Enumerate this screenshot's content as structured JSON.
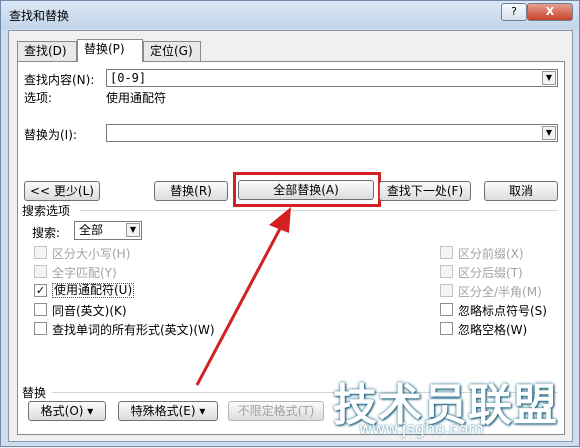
{
  "window": {
    "title": "查找和替换",
    "help_label": "?",
    "close_label": "X"
  },
  "tabs": [
    {
      "label": "查找(D)"
    },
    {
      "label": "替换(P)"
    },
    {
      "label": "定位(G)"
    }
  ],
  "find": {
    "label": "查找内容(N):",
    "value": "[0-9]"
  },
  "options": {
    "label": "选项:",
    "value": "使用通配符"
  },
  "replace": {
    "label": "替换为(I):",
    "value": ""
  },
  "buttons": {
    "less": "<< 更少(L)",
    "replace": "替换(R)",
    "replace_all": "全部替换(A)",
    "find_next": "查找下一处(F)",
    "cancel": "取消"
  },
  "search_options": {
    "title": "搜索选项",
    "search_label": "搜索:",
    "search_value": "全部",
    "left": [
      {
        "label": "区分大小写(H)",
        "checked": false,
        "disabled": true
      },
      {
        "label": "全字匹配(Y)",
        "checked": false,
        "disabled": true
      },
      {
        "label": "使用通配符(U)",
        "checked": true,
        "disabled": false
      },
      {
        "label": "同音(英文)(K)",
        "checked": false,
        "disabled": false
      },
      {
        "label": "查找单词的所有形式(英文)(W)",
        "checked": false,
        "disabled": false
      }
    ],
    "right": [
      {
        "label": "区分前缀(X)",
        "checked": false,
        "disabled": true
      },
      {
        "label": "区分后缀(T)",
        "checked": false,
        "disabled": true
      },
      {
        "label": "区分全/半角(M)",
        "checked": false,
        "disabled": true
      },
      {
        "label": "忽略标点符号(S)",
        "checked": false,
        "disabled": false
      },
      {
        "label": "忽略空格(W)",
        "checked": false,
        "disabled": false
      }
    ]
  },
  "replace_section": {
    "title": "替换",
    "format_label": "格式(O) ▾",
    "special_label": "特殊格式(E) ▾",
    "no_format_label": "不限定格式(T)"
  },
  "watermark": {
    "text": "技术员联盟",
    "url": "www.jsgho.com"
  },
  "colors": {
    "highlight": "#d42020",
    "arrow": "#d42020"
  }
}
